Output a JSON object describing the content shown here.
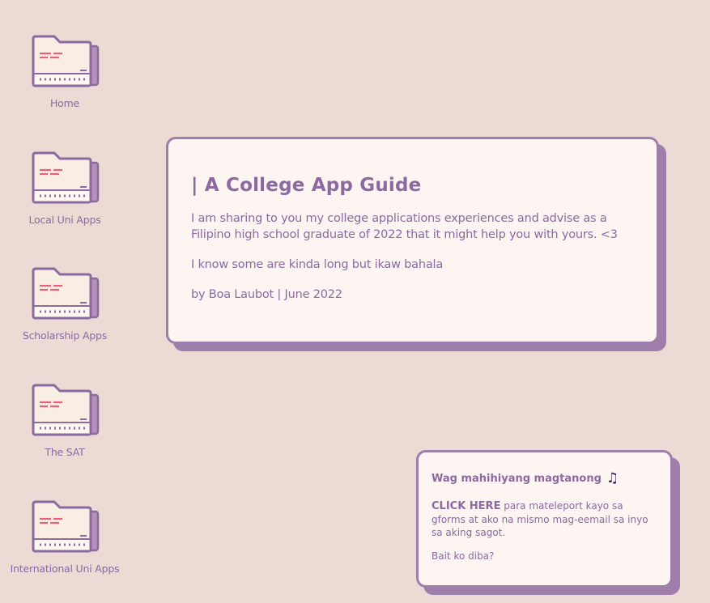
{
  "desktop": {
    "icons": [
      {
        "label": "Home",
        "icon": "folder-icon"
      },
      {
        "label": "Local Uni Apps",
        "icon": "folder-icon"
      },
      {
        "label": "Scholarship Apps",
        "icon": "folder-icon"
      },
      {
        "label": "The SAT",
        "icon": "folder-icon"
      },
      {
        "label": "International Uni Apps",
        "icon": "folder-icon"
      }
    ]
  },
  "main_window": {
    "title": "| A College App Guide",
    "paragraph1": "I am sharing to you my college applications experiences and advise as a Filipino high school graduate of 2022 that it might help you with yours. <3",
    "paragraph2": "I know some are kinda long but ikaw bahala",
    "byline": "by Boa Laubot | June 2022"
  },
  "note_window": {
    "title": "Wag mahihiyang magtanong",
    "title_icon": "music-note-icon",
    "link_text": "CLICK HERE",
    "link_rest": " para mateleport kayo sa gforms at ako na mismo mag-eemail sa inyo sa aking sagot.",
    "footer": "Bait ko diba?"
  },
  "colors": {
    "background": "#ecdad4",
    "window_bg": "#fdf5f2",
    "accent_purple": "#9e7eaa",
    "text_purple": "#8a6aa0",
    "folder_cream": "#f8eee4",
    "folder_red": "#e8607a"
  }
}
